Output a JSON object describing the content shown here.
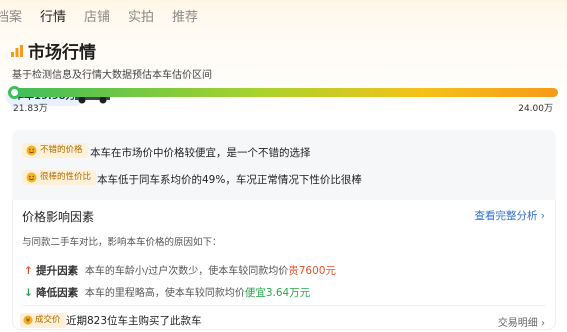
{
  "tabs": [
    {
      "label": "档案",
      "active": false
    },
    {
      "label": "行情",
      "active": true
    },
    {
      "label": "店铺",
      "active": false
    },
    {
      "label": "实拍",
      "active": false
    },
    {
      "label": "推荐",
      "active": false
    }
  ],
  "header": {
    "title": "市场行情",
    "subtitle": "基于检测信息及行情大数据预估本车估价区间",
    "price_tag": "本车19.98万"
  },
  "range_bar": {
    "min_label": "21.83万",
    "max_label": "24.00万",
    "colors": [
      "#3ebd5a",
      "#a8d22d",
      "#f4c21a",
      "#f59a1a"
    ]
  },
  "assessments": [
    {
      "badge": "不错的价格",
      "text": "本车在市场价中价格较便宜，是一个不错的选择"
    },
    {
      "badge": "很棒的性价比",
      "text": "本车低于同车系均价的49%，车况正常情况下性价比很棒"
    }
  ],
  "factors_section": {
    "title": "价格影响因素",
    "link": "查看完整分析 ›",
    "description": "与同款二手车对比，影响本车价格的原因如下：",
    "up": {
      "arrow": "↑",
      "label": "提升因素",
      "detail": "本车的车龄小/过户次数少，使本车较同款均价",
      "highlight": "贵7600元"
    },
    "down": {
      "arrow": "↓",
      "label": "降低因素",
      "detail": "本车的里程略高，使本车较同款均价",
      "highlight": "便宜3.64万元"
    }
  },
  "deals": {
    "badge": "成交价",
    "text": "近期823位车主购买了此款车",
    "link": "交易明细 ›"
  },
  "accent_color": "#e8542a"
}
